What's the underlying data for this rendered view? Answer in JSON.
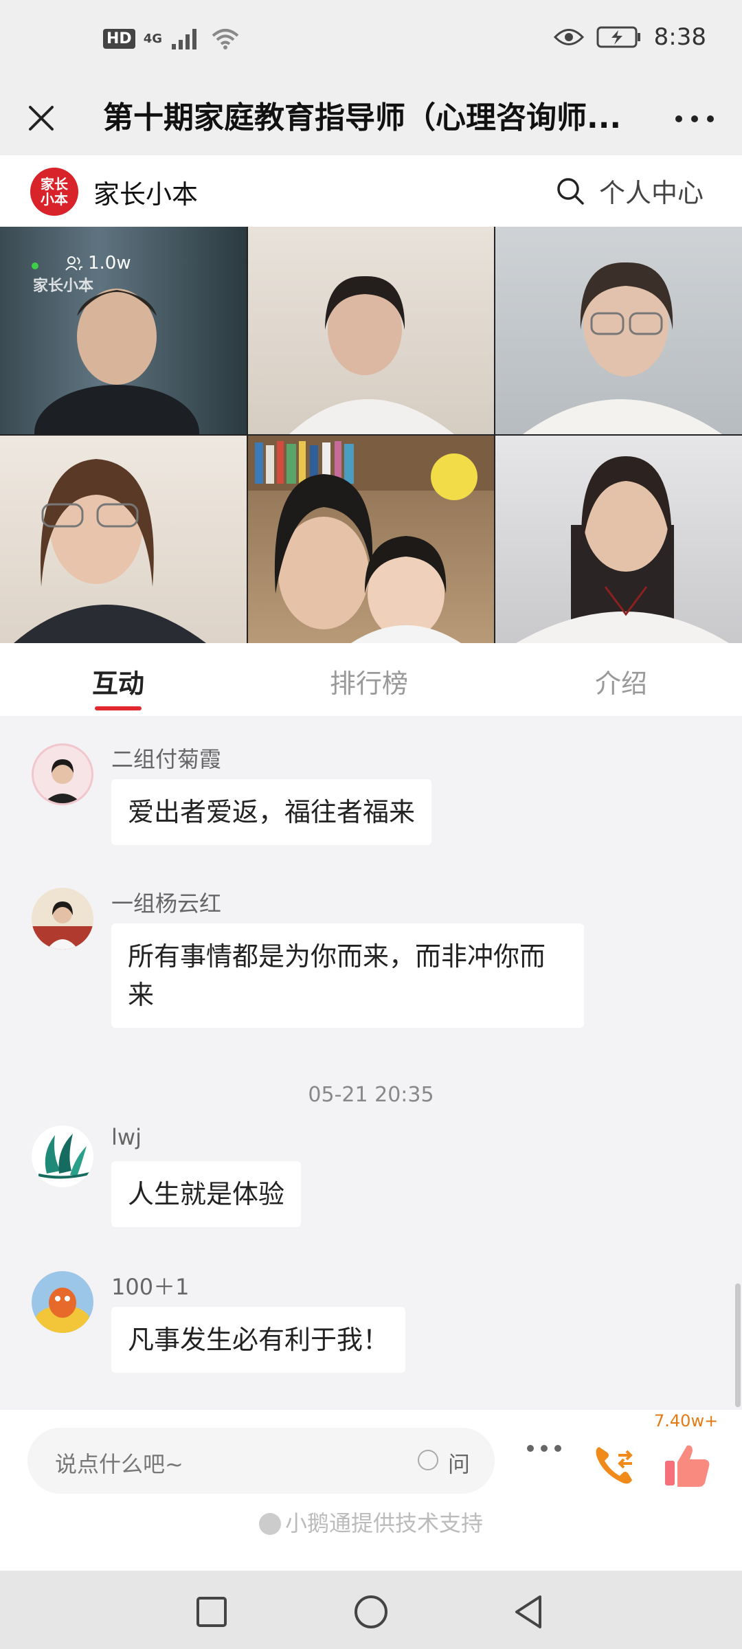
{
  "status_bar": {
    "hd": "HD",
    "network": "4G",
    "time": "8:38"
  },
  "title_bar": {
    "title": "第十期家庭教育指导师（心理咨询师..."
  },
  "brand_bar": {
    "brand_name": "家长小本",
    "logo_text": "家长小本",
    "personal_center": "个人中心"
  },
  "video": {
    "viewer_count": "1.0w",
    "watermark": "家长小本"
  },
  "tabs": [
    {
      "label": "互动",
      "active": true
    },
    {
      "label": "排行榜",
      "active": false
    },
    {
      "label": "介绍",
      "active": false
    }
  ],
  "chat": {
    "messages": [
      {
        "user": "二组付菊霞",
        "text": "爱出者爱返，福往者福来"
      },
      {
        "user": "一组杨云红",
        "text": "所有事情都是为你而来，而非冲你而来"
      },
      {
        "user": "lwj",
        "text": "人生就是体验"
      },
      {
        "user": "100＋1",
        "text": "凡事发生必有利于我！"
      }
    ],
    "timestamp": "05-21 20:35"
  },
  "input_bar": {
    "placeholder": "说点什么吧~",
    "ask_label": "问",
    "like_count": "7.40w+"
  },
  "footer": {
    "powered_by": "小鹅通提供技术支持"
  },
  "colors": {
    "accent": "#e2282f",
    "like_count": "#e07b16"
  }
}
